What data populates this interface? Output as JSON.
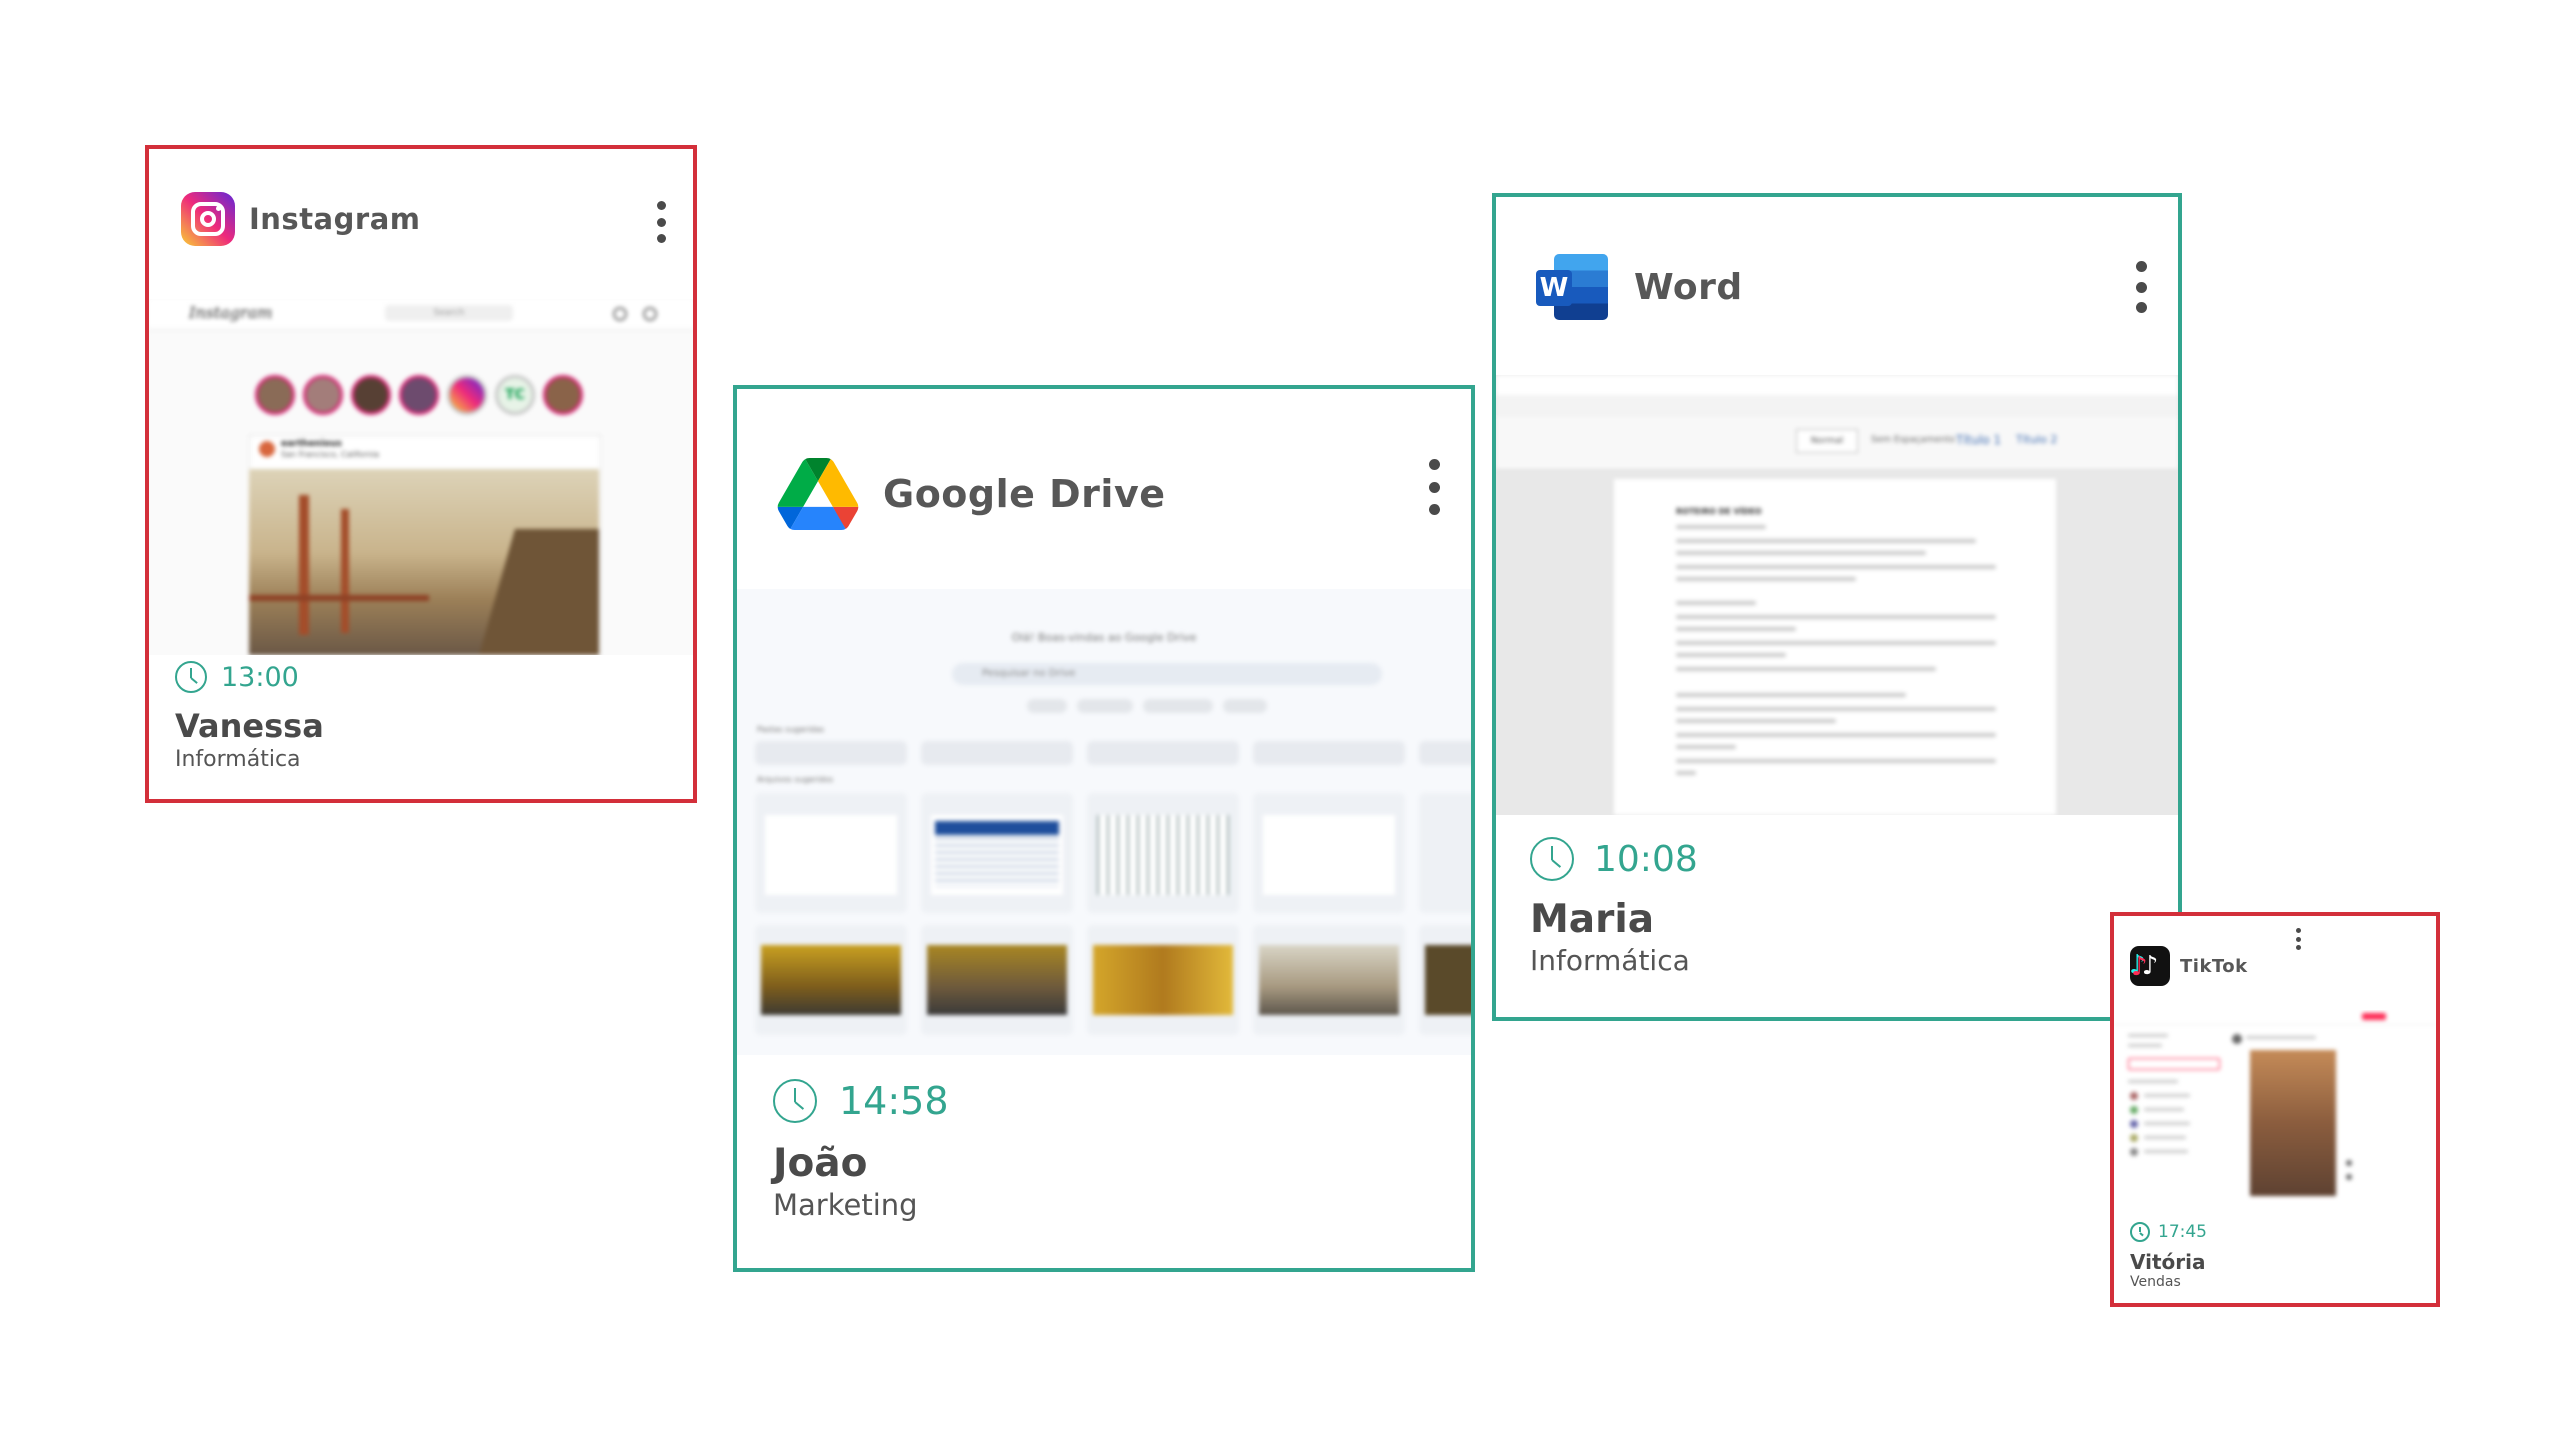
{
  "cards": {
    "instagram": {
      "app_name": "Instagram",
      "time": "13:00",
      "person": "Vanessa",
      "department": "Informática",
      "status_color": "#d32f3a",
      "screen": {
        "wordmark": "Instagram",
        "search": "Search",
        "post_user": "earthenious",
        "post_location": "San Francisco, California"
      }
    },
    "drive": {
      "app_name": "Google Drive",
      "time": "14:58",
      "person": "João",
      "department": "Marketing",
      "status_color": "#33a58f",
      "screen": {
        "welcome": "Olá! Boas-vindas ao Google Drive",
        "search": "Pesquisar no Drive",
        "suggested_folders": "Pastas sugeridas",
        "suggested_files": "Arquivos sugeridos"
      }
    },
    "word": {
      "app_name": "Word",
      "time": "10:08",
      "person": "Maria",
      "department": "Informática",
      "status_color": "#33a58f",
      "screen": {
        "doc_title": "ROTEIRO DE VÍDEO",
        "styles": [
          "Normal",
          "Sem Espaçamento",
          "Título 1",
          "Título 2"
        ]
      }
    },
    "tiktok": {
      "app_name": "TikTok",
      "time": "17:45",
      "person": "Vitória",
      "department": "Vendas",
      "status_color": "#d32f3a"
    }
  }
}
